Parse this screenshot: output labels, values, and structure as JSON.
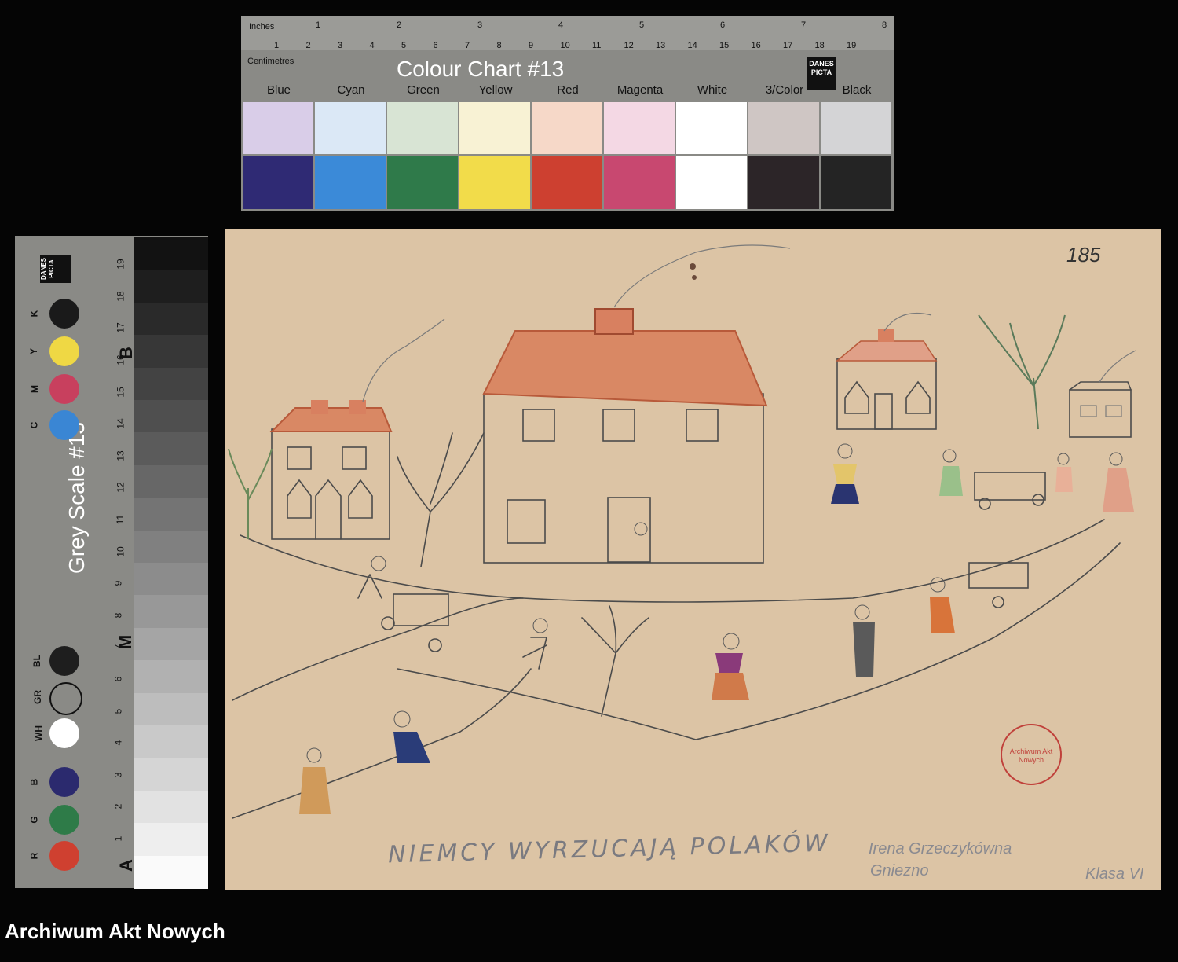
{
  "footer": {
    "label": "Archiwum Akt Nowych"
  },
  "color_chart": {
    "title": "Colour Chart #13",
    "inches_label": "Inches",
    "cm_label": "Centimetres",
    "logo_text": "DANES PICTA",
    "inch_ticks": [
      "1",
      "2",
      "3",
      "4",
      "5",
      "6",
      "7",
      "8"
    ],
    "cm_ticks": [
      "1",
      "2",
      "3",
      "4",
      "5",
      "6",
      "7",
      "8",
      "9",
      "10",
      "11",
      "12",
      "13",
      "14",
      "15",
      "16",
      "17",
      "18",
      "19"
    ],
    "patches": [
      {
        "name": "Blue",
        "light": "#d9cde8",
        "dark": "#2f2a74"
      },
      {
        "name": "Cyan",
        "light": "#dbe8f6",
        "dark": "#3b8ad8"
      },
      {
        "name": "Green",
        "light": "#d8e4d4",
        "dark": "#2f7a4a"
      },
      {
        "name": "Yellow",
        "light": "#f8f2d4",
        "dark": "#f2dc4a"
      },
      {
        "name": "Red",
        "light": "#f6d8c8",
        "dark": "#cd4030"
      },
      {
        "name": "Magenta",
        "light": "#f4d8e4",
        "dark": "#c84870"
      },
      {
        "name": "White",
        "light": "#ffffff",
        "dark": "#ffffff"
      },
      {
        "name": "3/Color",
        "light": "#cfc6c4",
        "dark": "#2c2528"
      },
      {
        "name": "Black",
        "light": "#d4d4d6",
        "dark": "#242424"
      }
    ]
  },
  "grey_scale": {
    "title": "Grey Scale #13",
    "logo_text": "DANES PICTA",
    "letter_a": "A",
    "letter_m": "M",
    "letter_b": "B",
    "steps": [
      "1",
      "2",
      "3",
      "4",
      "5",
      "6",
      "7",
      "8",
      "9",
      "10",
      "11",
      "12",
      "13",
      "14",
      "15",
      "16",
      "17",
      "18",
      "19"
    ],
    "dots": [
      {
        "label": "K",
        "color": "#1a1a1a"
      },
      {
        "label": "Y",
        "color": "#efd844"
      },
      {
        "label": "M",
        "color": "#c8405e"
      },
      {
        "label": "C",
        "color": "#3a86d4"
      },
      {
        "label": "BL",
        "color": "#1e1e1e"
      },
      {
        "label": "GR",
        "color": "#8a8a86"
      },
      {
        "label": "WH",
        "color": "#ffffff"
      },
      {
        "label": "B",
        "color": "#2b2a6e"
      },
      {
        "label": "G",
        "color": "#2e7b48"
      },
      {
        "label": "R",
        "color": "#cf4030"
      }
    ]
  },
  "drawing": {
    "caption": "NIEMCY WYRZUCAJĄ POLAKÓW",
    "page_number": "185",
    "author": "Irena Grzeczykówna",
    "place": "Gniezno",
    "class_label": "Klasa VI",
    "stamp_text": "Archiwum Akt Nowych"
  }
}
